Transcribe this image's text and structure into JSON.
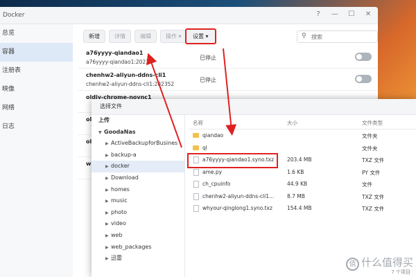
{
  "window": {
    "title": "Docker",
    "controls": [
      "?",
      "—",
      "☐",
      "✕"
    ]
  },
  "sidebar": {
    "items": [
      {
        "label": "总览",
        "active": false
      },
      {
        "label": "容器",
        "active": true
      },
      {
        "label": "注册表",
        "active": false
      },
      {
        "label": "映像",
        "active": false
      },
      {
        "label": "网络",
        "active": false
      },
      {
        "label": "日志",
        "active": false
      }
    ]
  },
  "toolbar": {
    "new_label": "新增",
    "details_label": "详情",
    "edit_label": "编辑",
    "action_label": "操作 ▾",
    "settings_label": "设置 ▾",
    "search_placeholder": "搜索"
  },
  "containers": [
    {
      "name": "a76yyyy-qiandao1",
      "image": "a76yyyy-qiandao1:2023",
      "status": "已停止"
    },
    {
      "name": "chenhw2-aliyun-ddns-cli1",
      "image": "chenhw2-aliyun-ddns-cli1:202352",
      "status": "已停止"
    },
    {
      "name": "oldiy-chrome-novnc1",
      "image": "",
      "status": ""
    },
    {
      "name": "ol",
      "image": "",
      "status": ""
    },
    {
      "name": "ol",
      "image": "",
      "status": ""
    },
    {
      "name": "w",
      "image": "",
      "status": ""
    }
  ],
  "dialog": {
    "title": "选择文件",
    "tree": {
      "upload": "上传",
      "nas": "GoodaNas",
      "folders": [
        "ActiveBackupforBusines",
        "backup-a",
        "docker",
        "Download",
        "homes",
        "music",
        "photo",
        "video",
        "web",
        "web_packages",
        "迅雷"
      ],
      "selected": "docker"
    },
    "columns": {
      "name": "名称",
      "size": "大小",
      "type": "文件类型"
    },
    "files": [
      {
        "name": "qiandao",
        "size": "",
        "type": "文件夹",
        "kind": "folder"
      },
      {
        "name": "ql",
        "size": "",
        "type": "文件夹",
        "kind": "folder"
      },
      {
        "name": "a76yyyy-qiandao1.syno.txz",
        "size": "203.4 MB",
        "type": "TXZ 文件",
        "kind": "file"
      },
      {
        "name": "ame.py",
        "size": "1.6 KB",
        "type": "PY 文件",
        "kind": "file"
      },
      {
        "name": "ch_cpuinfo",
        "size": "44.9 KB",
        "type": "文件",
        "kind": "file"
      },
      {
        "name": "chenhw2-aliyun-ddns-cli1...",
        "size": "8.7 MB",
        "type": "TXZ 文件",
        "kind": "file"
      },
      {
        "name": "whyour-qinglong1.syno.txz",
        "size": "154.4 MB",
        "type": "TXZ 文件",
        "kind": "file"
      }
    ],
    "footer": "7 个项目"
  },
  "watermark": {
    "text": "什么值得买",
    "logo": "值"
  },
  "colors": {
    "highlight_red": "#e02020",
    "selected_blue": "#dde9f6",
    "folder": "#f2c24c"
  }
}
